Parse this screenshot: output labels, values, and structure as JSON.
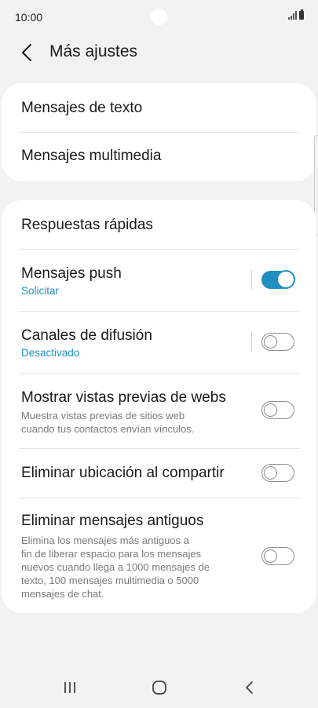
{
  "status_bar": {
    "time": "10:00"
  },
  "header": {
    "title": "Más ajustes",
    "back_icon": "chevron-left-icon"
  },
  "card1": {
    "items": [
      {
        "title": "Mensajes de texto"
      },
      {
        "title": "Mensajes multimedia"
      }
    ]
  },
  "card2": {
    "quick_replies": {
      "title": "Respuestas rápidas"
    },
    "push": {
      "title": "Mensajes push",
      "subtitle": "Solicitar",
      "enabled": true
    },
    "broadcast": {
      "title": "Canales de difusión",
      "subtitle": "Desactivado",
      "enabled": false
    },
    "web_previews": {
      "title": "Mostrar vistas previas de webs",
      "desc_line1": "Muestra vistas previas de sitios web",
      "desc_line2": "cuando tus contactos envían vínculos.",
      "enabled": false
    },
    "remove_location": {
      "title": "Eliminar ubicación al compartir",
      "enabled": false
    },
    "delete_old": {
      "title": "Eliminar mensajes antiguos",
      "desc_line1": "Elimina los mensajes más antiguos a",
      "desc_line2": "fin de liberar espacio para los mensajes",
      "desc_line3": "nuevos cuando llega a 1000 mensajes de",
      "desc_line4": "texto, 100 mensajes multimedia o 5000",
      "desc_line5": "mensajes de chat.",
      "enabled": false
    }
  },
  "colors": {
    "accent": "#1e8fbf",
    "background": "#f2f2f2",
    "card": "#ffffff"
  }
}
